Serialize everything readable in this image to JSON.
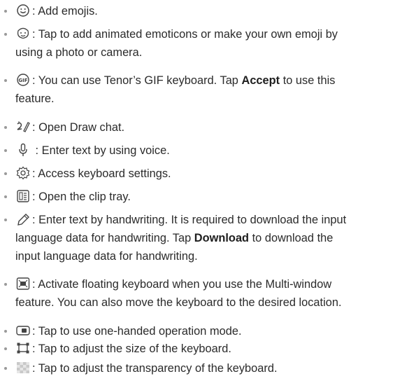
{
  "items": [
    {
      "icon": "smiley-emoji-icon",
      "lines": [
        [
          "",
          ": Add emojis."
        ]
      ]
    },
    {
      "icon": "animated-emoticon-icon",
      "lines": [
        [
          "",
          ": Tap to add animated emoticons or make your own emoji by"
        ],
        [
          "",
          "using a photo or camera."
        ]
      ]
    },
    {
      "icon": "gif-icon",
      "lines": [
        [
          "",
          ": You can use Tenor’s GIF keyboard. Tap "
        ],
        [
          "b",
          "Accept"
        ],
        [
          "",
          " to use this"
        ],
        [
          "br",
          ""
        ],
        [
          "",
          "feature."
        ]
      ]
    },
    {
      "icon": "draw-chat-icon",
      "lines": [
        [
          "",
          ": Open Draw chat."
        ]
      ]
    },
    {
      "icon": "microphone-icon",
      "lines": [
        [
          "",
          " : Enter text by using voice."
        ]
      ]
    },
    {
      "icon": "gear-settings-icon",
      "lines": [
        [
          "",
          ": Access keyboard settings."
        ]
      ]
    },
    {
      "icon": "clip-tray-icon",
      "lines": [
        [
          "",
          ": Open the clip tray."
        ]
      ]
    },
    {
      "icon": "handwriting-pen-icon",
      "lines": [
        [
          "",
          ": Enter text by handwriting. It is required to download the input"
        ],
        [
          "br",
          ""
        ],
        [
          "",
          "language data for handwriting. Tap "
        ],
        [
          "b",
          "Download"
        ],
        [
          "",
          " to download the"
        ],
        [
          "br",
          ""
        ],
        [
          "",
          "input language data for handwriting."
        ]
      ]
    },
    {
      "icon": "floating-keyboard-icon",
      "lines": [
        [
          "",
          ": Activate floating keyboard when you use the Multi-window"
        ],
        [
          "br",
          ""
        ],
        [
          "",
          "feature. You can also move the keyboard to the desired location."
        ]
      ]
    },
    {
      "icon": "one-handed-mode-icon",
      "lines": [
        [
          "",
          ": Tap to use one-handed operation mode."
        ]
      ]
    },
    {
      "icon": "resize-keyboard-icon",
      "lines": [
        [
          "",
          ": Tap to adjust the size of the keyboard."
        ]
      ]
    },
    {
      "icon": "transparency-icon",
      "lines": [
        [
          "",
          ": Tap to adjust the transparency of the keyboard."
        ]
      ]
    }
  ]
}
